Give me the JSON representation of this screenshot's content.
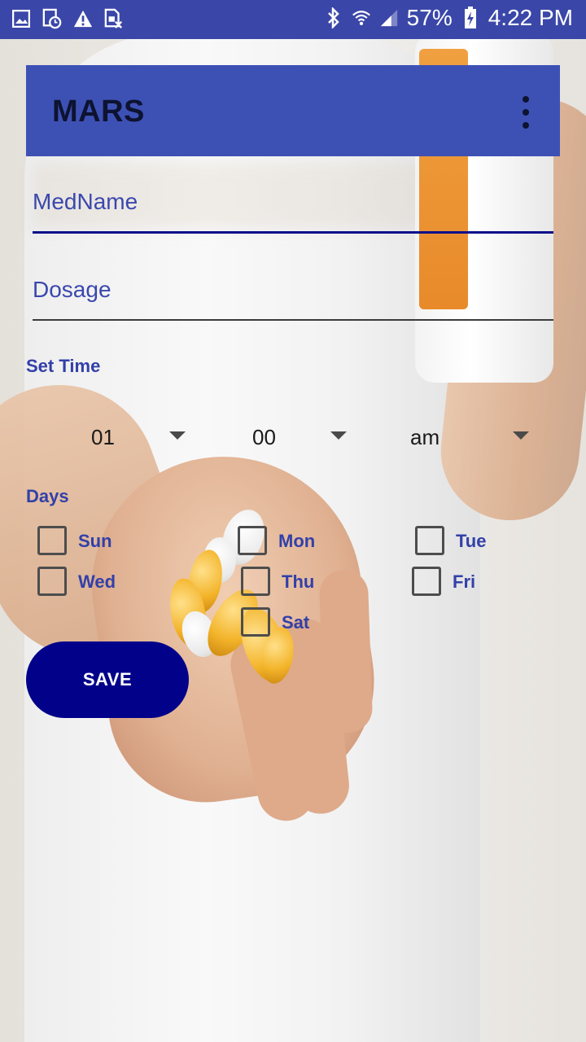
{
  "status_bar": {
    "battery": "57%",
    "time": "4:22 PM",
    "left_icons": [
      "image-icon",
      "calendar-clock-icon",
      "warning-icon",
      "sim-off-icon"
    ],
    "right_icons": [
      "bluetooth-icon",
      "wifi-icon",
      "signal-icon",
      "battery-charging-icon"
    ]
  },
  "toolbar": {
    "title": "MARS",
    "overflow_icon": "more-vert-icon"
  },
  "form": {
    "medname_placeholder": "MedName",
    "dosage_placeholder": "Dosage",
    "set_time_label": "Set Time",
    "hour": "01",
    "minute": "00",
    "ampm": "am",
    "days_label": "Days",
    "days": [
      "Sun",
      "Mon",
      "Tue",
      "Wed",
      "Thu",
      "Fri",
      "Sat"
    ],
    "save_label": "SAVE"
  },
  "colors": {
    "status_bar": "#3a47a8",
    "toolbar": "#3d51b5",
    "accent_text": "#3240a8",
    "save_button": "#01018a"
  }
}
